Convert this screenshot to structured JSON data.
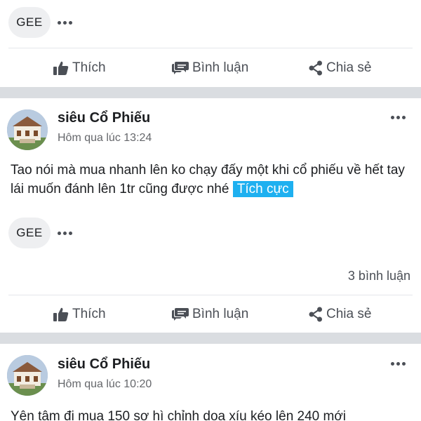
{
  "reactions": {
    "label": "GEE"
  },
  "actions": {
    "like": "Thích",
    "comment": "Bình luận",
    "share": "Chia sẻ"
  },
  "posts": [
    {
      "author": "siêu Cổ Phiếu",
      "time": "Hôm qua lúc 13:24",
      "text": "Tao nói mà mua nhanh lên ko chạy đấy một khi cổ phiếu về hết tay lái muốn đánh lên 1tr cũng được nhé",
      "tag": "Tích cực",
      "comment_count": "3 bình luận"
    },
    {
      "author": "siêu Cổ Phiếu",
      "time": "Hôm qua lúc 10:20",
      "text": "Yên tâm đi mua 150 sơ hì chỉnh dọa xíu kéo lên 240 mới"
    }
  ],
  "colors": {
    "tag_bg": "#1eb0f0",
    "separator": "#dadde1",
    "muted": "#65676b"
  },
  "icons": [
    "more-dots-icon",
    "thumbs-up-icon",
    "comment-icon",
    "share-icon"
  ]
}
